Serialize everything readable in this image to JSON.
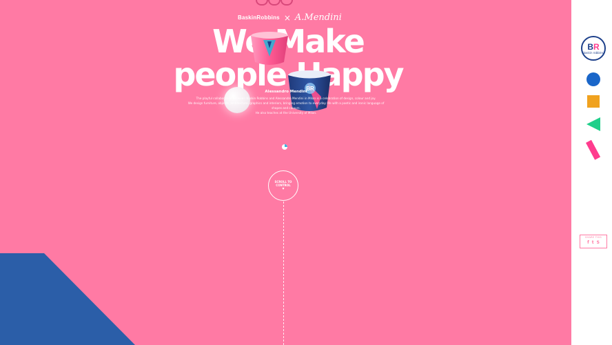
{
  "header": {
    "brand_left": "BaskinRobbins",
    "brand_x": "×",
    "brand_right": "A.Mendini"
  },
  "hero": {
    "line1": "We Make",
    "line2": "people Happy"
  },
  "intro": {
    "name": "Alessandro Mendini",
    "paragraph_1": "The playful collaboration between Baskin Robbins and Alessandro Mendini in Milan is a celebration of design, colour and joy.",
    "paragraph_2": "We design furniture, objects, architecture, graphics and interiors, bringing emotion to everyday life with a poetic and ironic language of shapes and colours.",
    "paragraph_3": "He also teaches at the University of Milan."
  },
  "scroll": {
    "line1": "SCROLL TO",
    "line2": "CONTROL",
    "arrow": "▾"
  },
  "sidebar": {
    "logo_text_b": "B",
    "logo_text_r": "R",
    "logo_small": "baskin robbins",
    "share_label": "SHARE THIS",
    "share_icons": [
      "f",
      "t",
      "S"
    ]
  },
  "colors": {
    "background": "#ff7aa4",
    "blue": "#2b5ea8",
    "circle": "#1a66c9",
    "square": "#f0a21f",
    "triangle": "#1fcf8a",
    "rect": "#ff3c8e"
  }
}
